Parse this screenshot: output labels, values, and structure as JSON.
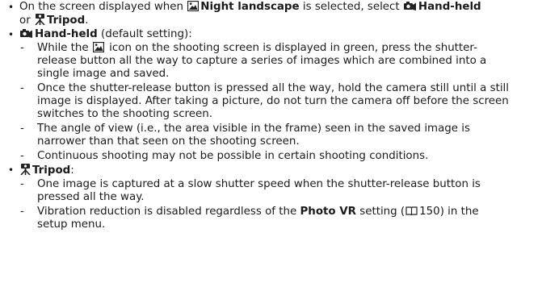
{
  "intro": {
    "line1_pre": "On the screen displayed when",
    "night_landscape": "Night landscape",
    "line1_mid": "is selected, select",
    "hand_held": "Hand-held",
    "line2_pre": "or",
    "tripod": "Tripod",
    "line2_post": "."
  },
  "hand_held": {
    "title": "Hand-held",
    "title_note": "(default setting):",
    "item1_l1_pre": "While the",
    "item1_l1_post": "icon on the shooting screen is displayed in green, press the shutter-",
    "item1_l2": "release button all the way to capture a series of images which are combined into a",
    "item1_l3": "single image and saved.",
    "item2_l1": "Once the shutter-release button is pressed all the way, hold the camera still until a still",
    "item2_l2": "image is displayed. After taking a picture, do not turn the camera off before the screen",
    "item2_l3": "switches to the shooting screen.",
    "item3_l1": "The angle of view (i.e., the area visible in the frame) seen in the saved image is",
    "item3_l2": "narrower than that seen on the shooting screen.",
    "item4_l1": "Continuous shooting may not be possible in certain shooting conditions."
  },
  "tripod": {
    "title": "Tripod",
    "title_colon": ":",
    "item1_l1": "One image is captured at a slow shutter speed when the shutter-release button is",
    "item1_l2": "pressed all the way.",
    "item2_l1_pre": "Vibration reduction is disabled regardless of the",
    "photo_vr": "Photo VR",
    "item2_l1_mid": "setting (",
    "page_ref": "150",
    "item2_l1_post": ") in the",
    "item2_l2": "setup menu."
  }
}
